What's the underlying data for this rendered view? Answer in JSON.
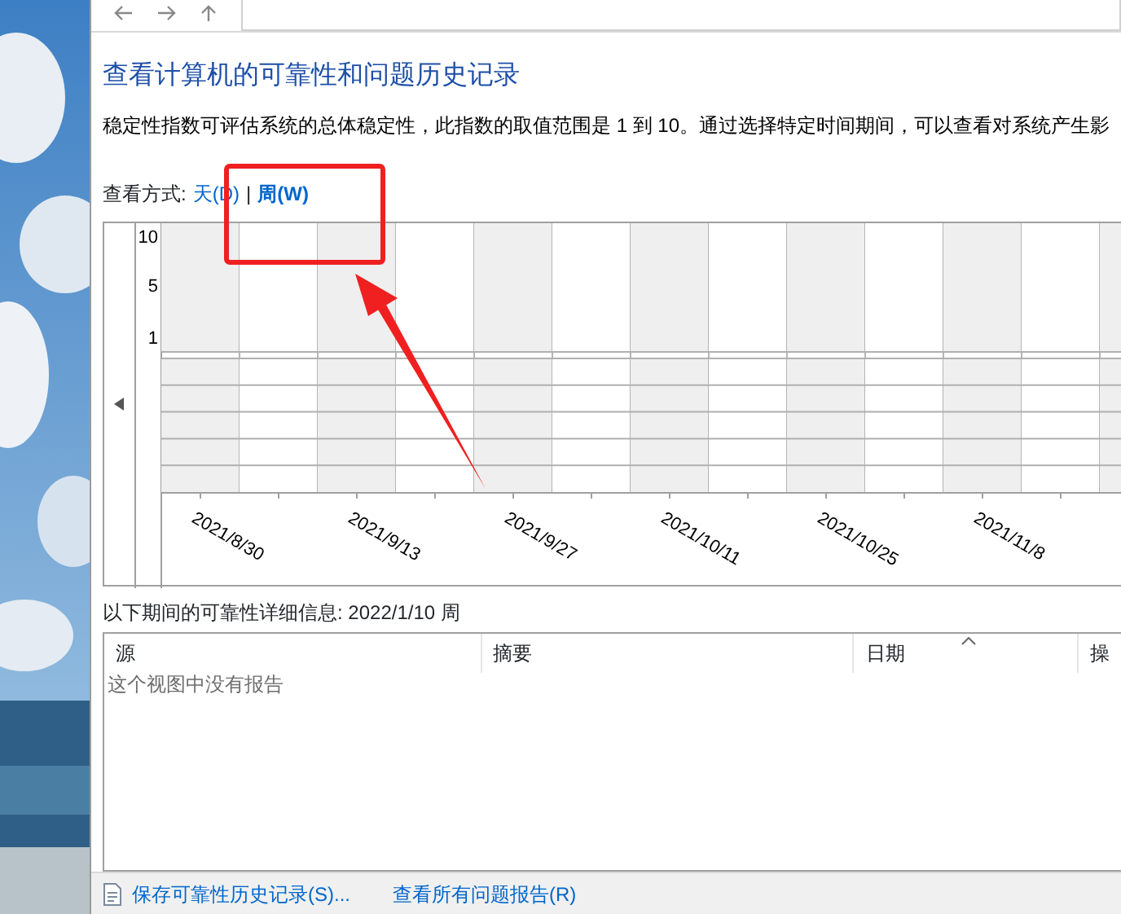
{
  "title": "查看计算机的可靠性和问题历史记录",
  "description": "稳定性指数可评估系统的总体稳定性，此指数的取值范围是 1 到 10。通过选择特定时间期间，可以查看对系统产生影",
  "view_by": {
    "label": "查看方式:",
    "separator": "|",
    "options": [
      {
        "label": "天(D)",
        "selected": false
      },
      {
        "label": "周(W)",
        "selected": true
      }
    ]
  },
  "chart": {
    "yticks": [
      "10",
      "5",
      "1"
    ],
    "dates": [
      "2021/8/30",
      "2021/9/13",
      "2021/9/27",
      "2021/10/11",
      "2021/10/25",
      "2021/11/8"
    ]
  },
  "details_label": "以下期间的可靠性详细信息: 2022/1/10 周",
  "table": {
    "columns": [
      {
        "label": "源",
        "sorted": false
      },
      {
        "label": "摘要",
        "sorted": false
      },
      {
        "label": "日期",
        "sorted": true
      },
      {
        "label": "操",
        "sorted": false
      }
    ],
    "empty_text": "这个视图中没有报告"
  },
  "footer_links": [
    "保存可靠性历史记录(S)...",
    "查看所有问题报告(R)"
  ],
  "annotations": {
    "highlight_box": true,
    "arrow": true
  }
}
